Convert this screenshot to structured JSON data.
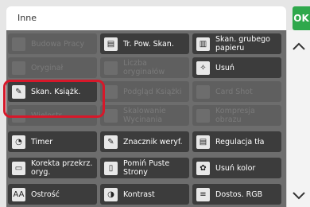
{
  "header": {
    "title": "Inne",
    "ok_label": "OK"
  },
  "rows": [
    [
      {
        "label": "Budowa Pracy",
        "icon": "job-build-icon",
        "enabled": false
      },
      {
        "label": "Tr. Pow. Skan.",
        "icon": "scan-document-icon",
        "enabled": true
      },
      {
        "label": "Skan. grubego papieru",
        "icon": "thick-paper-scan-icon",
        "enabled": true
      }
    ],
    [
      {
        "label": "Oryginał",
        "icon": "original-icon",
        "enabled": false
      },
      {
        "label": "Liczba oryginałów",
        "icon": "original-count-icon",
        "enabled": false
      },
      {
        "label": "Usuń",
        "icon": "erase-icon",
        "enabled": true
      }
    ],
    [
      {
        "label": "Skan. Książk.",
        "icon": "book-scan-icon",
        "enabled": true,
        "highlighted": true
      },
      {
        "label": "Podgląd Książki",
        "icon": "book-preview-icon",
        "enabled": false
      },
      {
        "label": "Card Shot",
        "icon": "card-shot-icon",
        "enabled": false
      }
    ],
    [
      {
        "label": "Wielostr.",
        "icon": "multipage-icon",
        "enabled": false
      },
      {
        "label": "Skalowanie Wycinania",
        "icon": "crop-scale-icon",
        "enabled": false
      },
      {
        "label": "Kompresja obrazu",
        "icon": "compression-icon",
        "enabled": false
      }
    ],
    [
      {
        "label": "Timer",
        "icon": "clock-icon",
        "enabled": true
      },
      {
        "label": "Znacznik weryf.",
        "icon": "verification-stamp-icon",
        "enabled": true
      },
      {
        "label": "Regulacja tła",
        "icon": "background-adjust-icon",
        "enabled": true
      }
    ],
    [
      {
        "label": "Korekta przekrz. oryg.",
        "icon": "skew-correction-icon",
        "enabled": true
      },
      {
        "label": "Pomiń Puste Strony",
        "icon": "skip-blank-icon",
        "enabled": true
      },
      {
        "label": "Usuń kolor",
        "icon": "color-remove-icon",
        "enabled": true
      }
    ],
    [
      {
        "label": "Ostrość",
        "icon": "sharpness-icon",
        "enabled": true
      },
      {
        "label": "Kontrast",
        "icon": "contrast-icon",
        "enabled": true
      },
      {
        "label": "Dostos. RGB",
        "icon": "rgb-adjust-icon",
        "enabled": true
      }
    ]
  ],
  "colors": {
    "ok": "#2ea84c",
    "highlight": "#d7182a",
    "button": "#3c3c3c",
    "panel": "#6d6d6d"
  }
}
